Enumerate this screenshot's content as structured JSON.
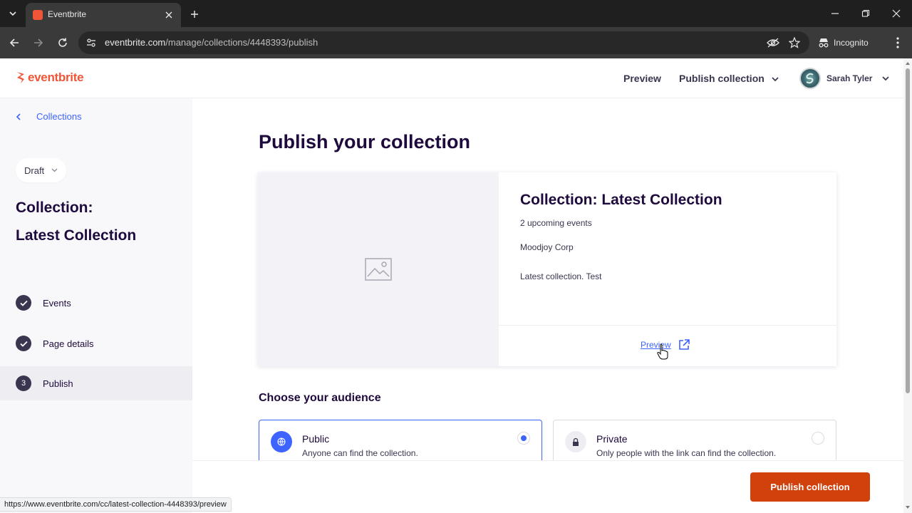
{
  "browser": {
    "tab_title": "Eventbrite",
    "url_host": "eventbrite.com",
    "url_path": "/manage/collections/4448393/publish",
    "incognito_label": "Incognito",
    "status_url": "https://www.eventbrite.com/cc/latest-collection-4448393/preview"
  },
  "header": {
    "logo_text": "eventbrite",
    "preview_label": "Preview",
    "publish_menu_label": "Publish collection",
    "user_name": "Sarah Tyler"
  },
  "sidebar": {
    "back_label": "Collections",
    "status": "Draft",
    "title_line1": "Collection:",
    "title_line2": "Latest Collection",
    "steps": [
      {
        "label": "Events",
        "badge": ""
      },
      {
        "label": "Page details",
        "badge": ""
      },
      {
        "label": "Publish",
        "badge": "3"
      }
    ]
  },
  "main": {
    "title": "Publish your collection",
    "card": {
      "title": "Collection: Latest Collection",
      "upcoming": "2 upcoming events",
      "organizer": "Moodjoy Corp",
      "description": "Latest collection. Test",
      "preview_link": "Preview"
    },
    "audience_title": "Choose your audience",
    "audience": [
      {
        "title": "Public",
        "desc": "Anyone can find the collection.",
        "selected": true
      },
      {
        "title": "Private",
        "desc": "Only people with the link can find the collection.",
        "selected": false
      }
    ],
    "publish_button": "Publish collection"
  },
  "colors": {
    "brand": "#f05537",
    "publish_button": "#d1410c",
    "link": "#3d64ff",
    "heading": "#1e0a3c"
  }
}
